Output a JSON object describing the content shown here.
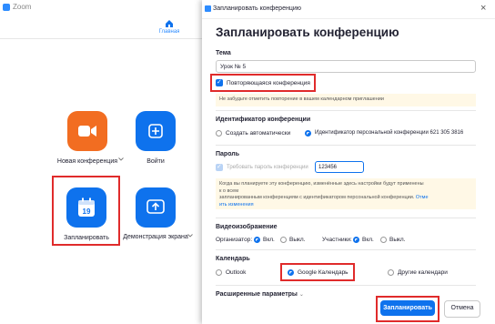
{
  "main": {
    "title": "Zoom",
    "home_label": "Главная",
    "actions": [
      {
        "label": "Новая конференция"
      },
      {
        "label": "Войти"
      },
      {
        "label": "Запланировать"
      },
      {
        "label": "Демонстрация экрана"
      }
    ]
  },
  "dialog": {
    "title": "Запланировать конференцию",
    "close": "×",
    "heading": "Запланировать конференцию",
    "topic": {
      "label": "Тема",
      "value": "Урок № 5"
    },
    "recurring": {
      "label": "Повторяющаяся конференция",
      "checked": true
    },
    "recurring_note": "Не забудьте отметить повторение в вашем календарном приглашении",
    "meeting_id": {
      "label": "Идентификатор конференции",
      "options": [
        "Создать автоматически",
        "Идентификатор персональной конференции 621 305 3816"
      ],
      "selected": 1
    },
    "password": {
      "label": "Пароль",
      "require_label": "Требовать пароль конференции",
      "value": "123456",
      "note": "Когда вы планируете эту конференцию, изменённые здесь настройки будут применены к о всем запланированным конференциям с идентификатором персональной конференции. Отме",
      "note_line1": "Когда вы планируете эту конференцию, изменённые здесь настройки будут применены",
      "note_line2": "к о всем",
      "note_line3": "запланированным конференциям с идентификатором персональной конференции.",
      "note_link": "Отме",
      "note_line4": "ить изменения"
    },
    "video": {
      "label": "Видеоизображение",
      "host_label": "Организатор:",
      "participants_label": "Участники:",
      "on": "Вкл.",
      "off": "Выкл.",
      "host_on": true,
      "participants_on": true
    },
    "calendar": {
      "label": "Календарь",
      "options": [
        "Outlook",
        "Google Календарь",
        "Другие календари"
      ],
      "selected": 1
    },
    "advanced_label": "Расширенные параметры",
    "schedule_button": "Запланировать",
    "cancel_button": "Отмена"
  },
  "colors": {
    "accent": "#0E72ED",
    "orange": "#F26D21",
    "highlight": "#E02B2B"
  }
}
